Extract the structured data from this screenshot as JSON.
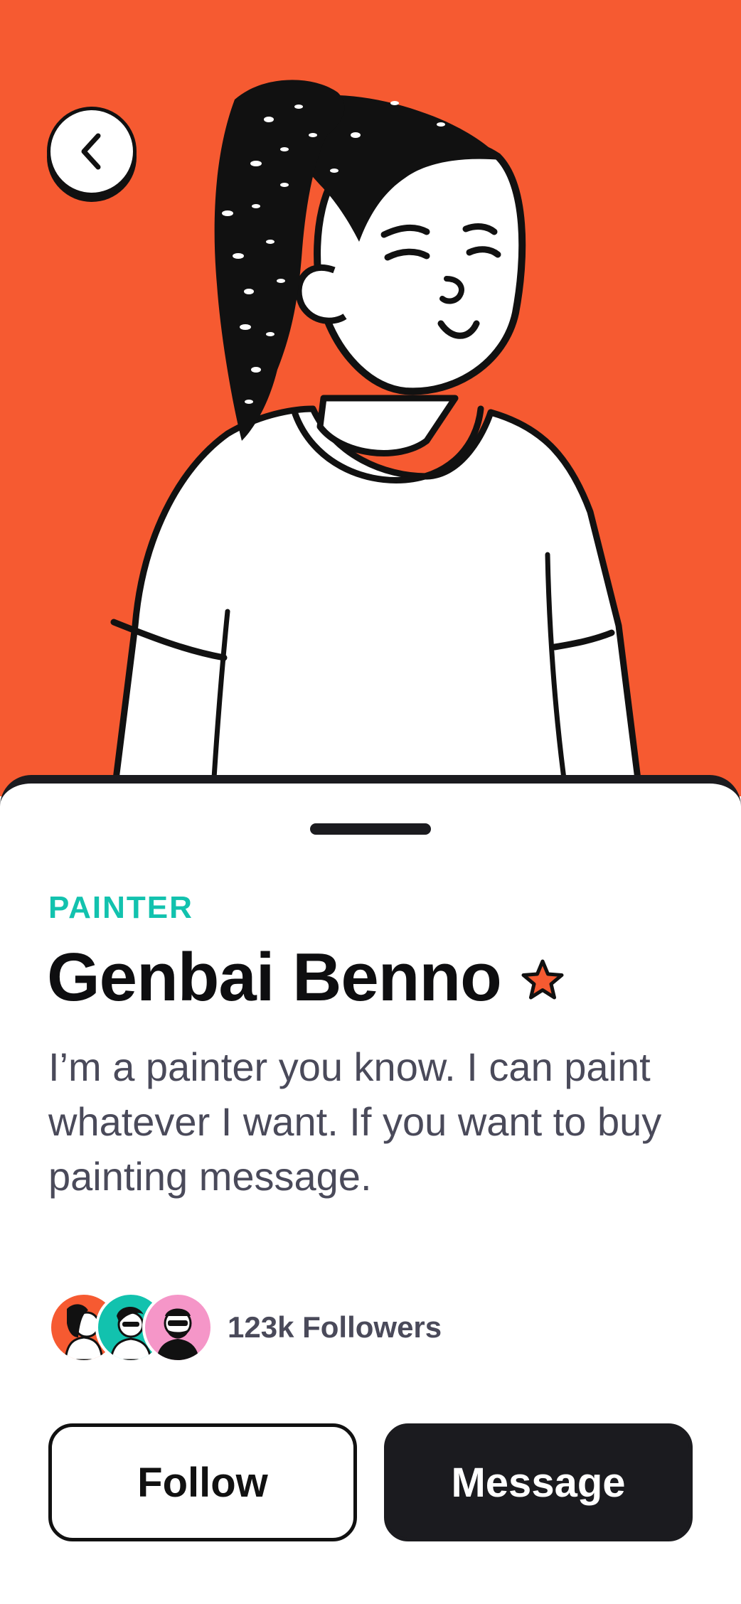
{
  "profile": {
    "role": "PAINTER",
    "name": "Genbai Benno",
    "bio": "I’m a painter you know. I can paint whatever I want. If you want to buy painting message.",
    "followers_label": "123k Followers"
  },
  "actions": {
    "follow_label": "Follow",
    "message_label": "Message"
  },
  "icons": {
    "back": "chevron-left-icon",
    "favorite": "star-icon"
  },
  "colors": {
    "hero_background": "#F65A31",
    "accent_teal": "#12C2AE",
    "dark": "#1B1B1F",
    "avatar_orange": "#F65A31",
    "avatar_teal": "#12C2AE",
    "avatar_pink": "#F596C8"
  }
}
